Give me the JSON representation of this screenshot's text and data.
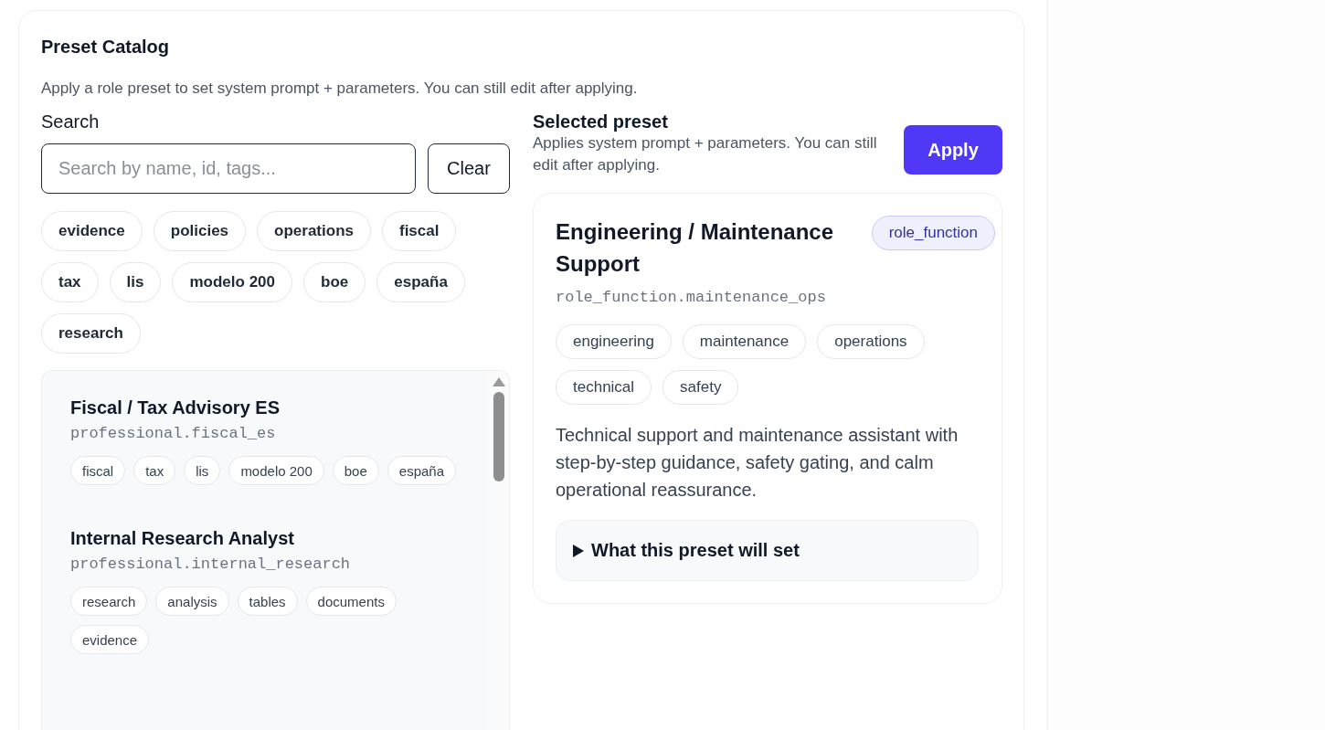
{
  "catalog": {
    "title": "Preset Catalog",
    "description": "Apply a role preset to set system prompt + parameters. You can still edit after applying."
  },
  "search": {
    "label": "Search",
    "placeholder": "Search by name, id, tags...",
    "clear_button": "Clear"
  },
  "tag_filters": [
    {
      "label": "evidence",
      "selected": false
    },
    {
      "label": "policies",
      "selected": false
    },
    {
      "label": "operations",
      "selected": false
    },
    {
      "label": "fiscal",
      "selected": false
    },
    {
      "label": "tax",
      "selected": false
    },
    {
      "label": "lis",
      "selected": false
    },
    {
      "label": "modelo 200",
      "selected": false
    },
    {
      "label": "boe",
      "selected": false
    },
    {
      "label": "españa",
      "selected": false
    },
    {
      "label": "research",
      "selected": false
    }
  ],
  "presets": [
    {
      "name": "Fiscal / Tax Advisory ES",
      "id": "professional.fiscal_es",
      "tags": [
        "fiscal",
        "tax",
        "lis",
        "modelo 200",
        "boe",
        "españa"
      ]
    },
    {
      "name": "Internal Research Analyst",
      "id": "professional.internal_research",
      "tags": [
        "research",
        "analysis",
        "tables",
        "documents",
        "evidence"
      ]
    }
  ],
  "selected_preset": {
    "heading": "Selected preset",
    "note": "Applies system prompt + parameters. You can still edit after applying.",
    "apply_button": "Apply",
    "name": "Engineering / Maintenance Support",
    "category": "role_function",
    "id": "role_function.maintenance_ops",
    "tags": [
      "engineering",
      "maintenance",
      "operations",
      "technical",
      "safety"
    ],
    "description": "Technical support and maintenance assistant with step-by-step guidance, safety gating, and calm operational reassurance.",
    "details": {
      "summary": "What this preset will set",
      "expanded": false
    }
  }
}
